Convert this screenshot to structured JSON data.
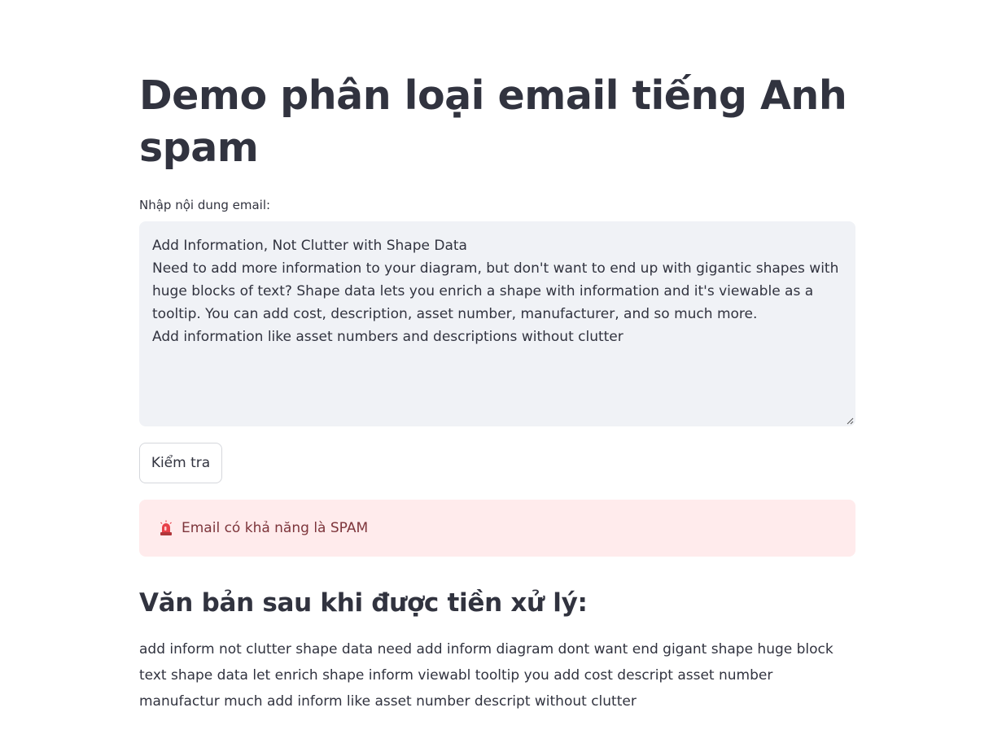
{
  "page": {
    "title": "Demo phân loại email tiếng Anh spam"
  },
  "form": {
    "label": "Nhập nội dung email:",
    "email_text": "Add Information, Not Clutter with Shape Data\nNeed to add more information to your diagram, but don't want to end up with gigantic shapes with huge blocks of text? Shape data lets you enrich a shape with information and it's viewable as a tooltip. You can add cost, description, asset number, manufacturer, and so much more.\nAdd information like asset numbers and descriptions without clutter",
    "button_label": "Kiểm tra"
  },
  "result": {
    "icon": "siren-icon",
    "message": "Email có khả năng là SPAM",
    "color": "#7d353b",
    "background": "#ffebec"
  },
  "preprocessed": {
    "heading": "Văn bản sau khi được tiền xử lý:",
    "text": "add inform not clutter shape data need add inform diagram dont want end gigant shape huge block text shape data let enrich shape inform viewabl tooltip you add cost descript asset number manufactur much add inform like asset number descript without clutter"
  }
}
